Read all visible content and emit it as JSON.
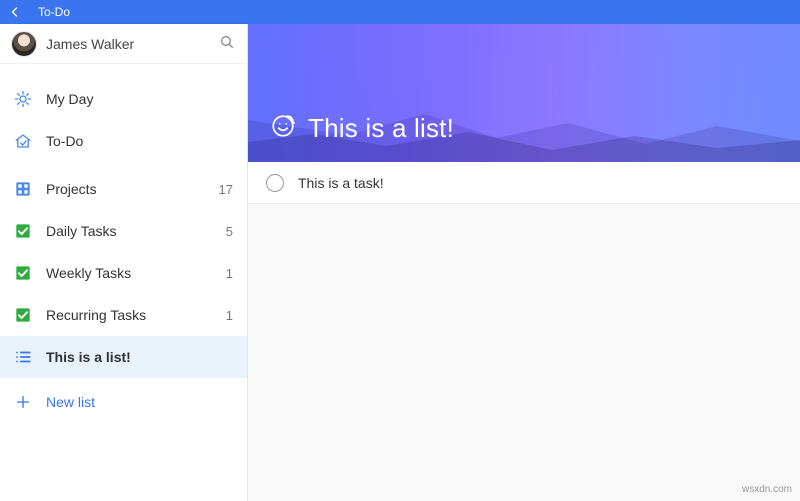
{
  "titlebar": {
    "app_name": "To-Do"
  },
  "user": {
    "name": "James Walker"
  },
  "sidebar": {
    "items": [
      {
        "icon": "sun",
        "label": "My Day",
        "count": ""
      },
      {
        "icon": "home",
        "label": "To-Do",
        "count": ""
      },
      {
        "icon": "grid",
        "label": "Projects",
        "count": "17"
      },
      {
        "icon": "check",
        "label": "Daily Tasks",
        "count": "5"
      },
      {
        "icon": "check",
        "label": "Weekly Tasks",
        "count": "1"
      },
      {
        "icon": "check",
        "label": "Recurring Tasks",
        "count": "1"
      },
      {
        "icon": "list",
        "label": "This is a list!",
        "count": "",
        "selected": true
      }
    ],
    "new_list_label": "New list"
  },
  "main": {
    "list_title": "This is a list!",
    "list_emoji": "smiley",
    "tasks": [
      {
        "title": "This is a task!",
        "completed": false
      }
    ]
  },
  "watermark": "wsxdn.com",
  "colors": {
    "accent": "#3a74ef",
    "check_green": "#2fab3f",
    "hero_start": "#5f6fff",
    "hero_end": "#6f8bff"
  }
}
